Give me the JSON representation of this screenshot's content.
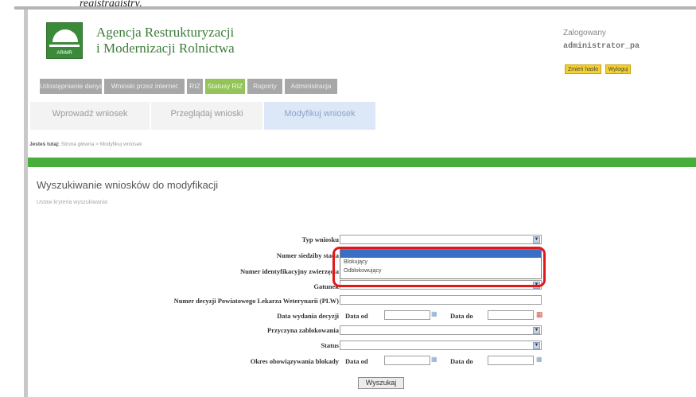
{
  "caption": "registragistry,",
  "header": {
    "agency_line1": "Agencja Restrukturyzacji",
    "agency_line2": "i Modernizacji Rolnictwa",
    "logo_text": "ARIMR",
    "logged_in_label": "Zalogowany",
    "username": "administrator_pa",
    "change_password_label": "Zmień hasło",
    "logout_label": "Wyloguj"
  },
  "menu_primary": [
    "Udostępnianie danych",
    "Wnioski przez internet",
    "RIZ",
    "Statusy RIZ",
    "Raporty",
    "Administracja"
  ],
  "menu_secondary": [
    "Wprowadź wniosek",
    "Przeglądaj wnioski",
    "Modyfikuj wniosek"
  ],
  "breadcrumb": {
    "label": "Jesteś tutaj:",
    "path": "Strona główna > Modyfikuj wniosek"
  },
  "section": {
    "title": "Wyszukiwanie wniosków do modyfikacji",
    "subtitle": "Ustaw kryteria wyszukiwania"
  },
  "form": {
    "typ_wniosku": "Typ wniosku",
    "numer_siedziby": "Numer siedziby stada",
    "numer_zwierzecia": "Numer identyfikacyjny zwierzęcia",
    "gatunek": "Gatunek",
    "numer_decyzji": "Numer decyzji Powiatowego Lekarza Weterynarii (PLW)",
    "data_wydania": "Data wydania decyzji",
    "przyczyna": "Przyczyna zablokowania",
    "status": "Status",
    "okres": "Okres obowiązywania blokady",
    "data_od": "Data od",
    "data_do": "Data do",
    "search_button": "Wyszukaj"
  },
  "dropdown_options": [
    "Blokujący",
    "Odblokowujący"
  ],
  "colors": {
    "green_bar": "#47ae3b",
    "menu_active": "#92c457",
    "highlight": "#e21818",
    "logout_button": "#f4d02f"
  }
}
